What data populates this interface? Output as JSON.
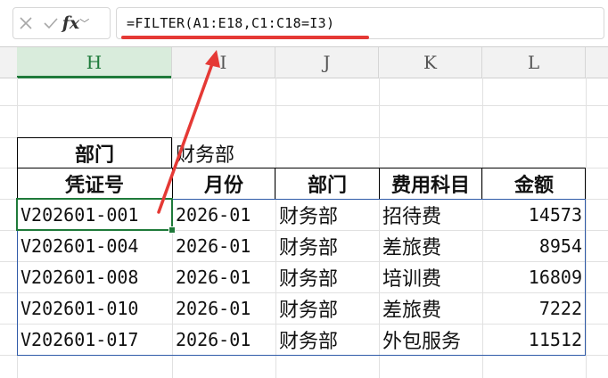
{
  "formula_bar": {
    "cancel_icon": "close-icon",
    "confirm_icon": "check-icon",
    "fx_label": "fx",
    "formula": "=FILTER(A1:E18,C1:C18=I3)"
  },
  "columns": [
    "H",
    "I",
    "J",
    "K",
    "L"
  ],
  "active_column": "H",
  "criteria": {
    "label": "部门",
    "value": "财务部"
  },
  "table": {
    "headers": [
      "凭证号",
      "月份",
      "部门",
      "费用科目",
      "金额"
    ],
    "rows": [
      [
        "V202601-001",
        "2026-01",
        "财务部",
        "招待费",
        "14573"
      ],
      [
        "V202601-004",
        "2026-01",
        "财务部",
        "差旅费",
        "8954"
      ],
      [
        "V202601-008",
        "2026-01",
        "财务部",
        "培训费",
        "16809"
      ],
      [
        "V202601-010",
        "2026-01",
        "财务部",
        "差旅费",
        "7222"
      ],
      [
        "V202601-017",
        "2026-01",
        "财务部",
        "外包服务",
        "11512"
      ]
    ]
  },
  "annotation": {
    "arrow_color": "#e53935"
  },
  "colors": {
    "selection": "#1f7a3a",
    "result_border": "#2f5aa8",
    "header_border": "#000000"
  }
}
